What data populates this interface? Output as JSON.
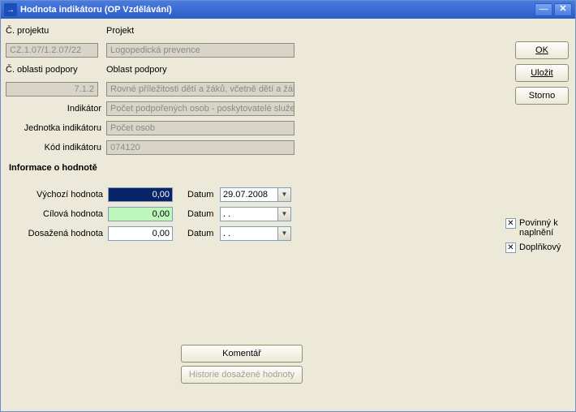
{
  "window": {
    "title": "Hodnota indikátoru   (OP Vzdělávání)",
    "icon_glyph": "→"
  },
  "header": {
    "col1_label": "Č. projektu",
    "col2_label": "Projekt",
    "project_num": "CZ.1.07/1.2.07/22",
    "project_name": "Logopedická prevence",
    "area_num_label": "Č. oblasti podpory",
    "area_label": "Oblast podpory",
    "area_num": "7.1.2",
    "area_name": "Rovné příležitosti dětí a žáků, včetně dětí a žák",
    "indicator_label": "Indikátor",
    "indicator_value": "Počet podpořených osob - poskytovatelé služe",
    "unit_label": "Jednotka indikátoru",
    "unit_value": "Počet osob",
    "code_label": "Kód indikátoru",
    "code_value": "074120"
  },
  "info": {
    "group_title": "Informace o hodnotě",
    "rows": {
      "start_label": "Výchozí hodnota",
      "start_value": "0,00",
      "start_date_label": "Datum",
      "start_date": "29.07.2008",
      "target_label": "Cílová hodnota",
      "target_value": "0,00",
      "target_date_label": "Datum",
      "target_date": " .  .    ",
      "reached_label": "Dosažená hodnota",
      "reached_value": "0,00",
      "reached_date_label": "Datum",
      "reached_date": " .  .    "
    }
  },
  "buttons": {
    "ok": "OK",
    "save": "Uložit",
    "storno": "Storno",
    "comment": "Komentář",
    "history": "Historie dosažené hodnoty"
  },
  "checks": {
    "mandatory": "Povinný k naplnění",
    "additional": "Doplňkový"
  }
}
